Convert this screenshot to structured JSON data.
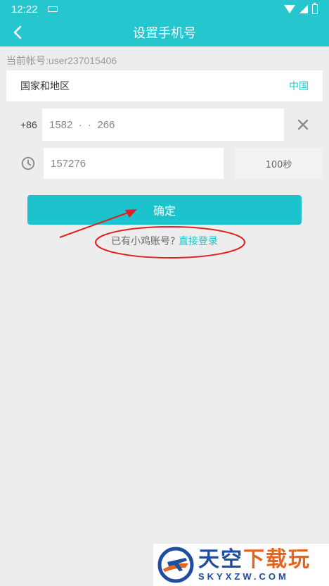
{
  "status": {
    "time": "12:22"
  },
  "header": {
    "title": "设置手机号"
  },
  "account": {
    "text": "当前帐号:user237015406"
  },
  "country": {
    "label": "国家和地区",
    "value": "中国"
  },
  "phone": {
    "prefix": "+86",
    "value": "1582  ·  ·  266"
  },
  "code": {
    "value": "157276",
    "timer": "100秒"
  },
  "confirm": {
    "label": "确定"
  },
  "login": {
    "question": "已有小鸡账号?",
    "link": "直接登录"
  },
  "watermark": {
    "cn_part1": "天空",
    "cn_part2": "下载玩",
    "en": "SKYXZW.COM"
  },
  "colors": {
    "accent": "#26c6cf",
    "annotation": "#e02020"
  }
}
